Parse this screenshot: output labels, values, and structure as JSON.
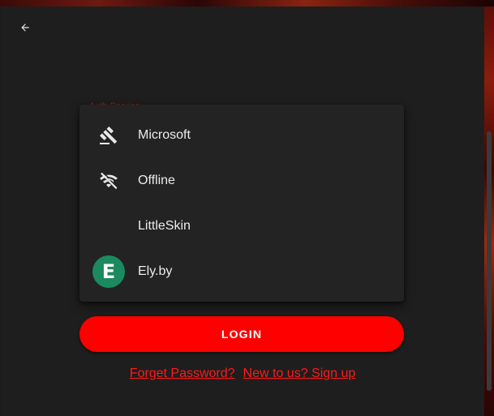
{
  "auth_service_label": "Auth Service",
  "back_icon": "arrow-left-icon",
  "auth_menu": {
    "items": [
      {
        "label": "Microsoft",
        "icon": "gavel-icon"
      },
      {
        "label": "Offline",
        "icon": "wifi-off-icon"
      },
      {
        "label": "LittleSkin",
        "icon": ""
      },
      {
        "label": "Ely.by",
        "icon": "elyby-logo-icon",
        "logo_letter": "E"
      }
    ]
  },
  "login_label": "LOGIN",
  "links": {
    "forget_password": "Forget Password?",
    "sign_up": "New to us? Sign up"
  },
  "colors": {
    "accent": "#ff0000",
    "link": "#ff1a1a",
    "background": "#1e1e1e",
    "menu_surface": "#232323",
    "elyby_green": "#1b8a5f"
  }
}
